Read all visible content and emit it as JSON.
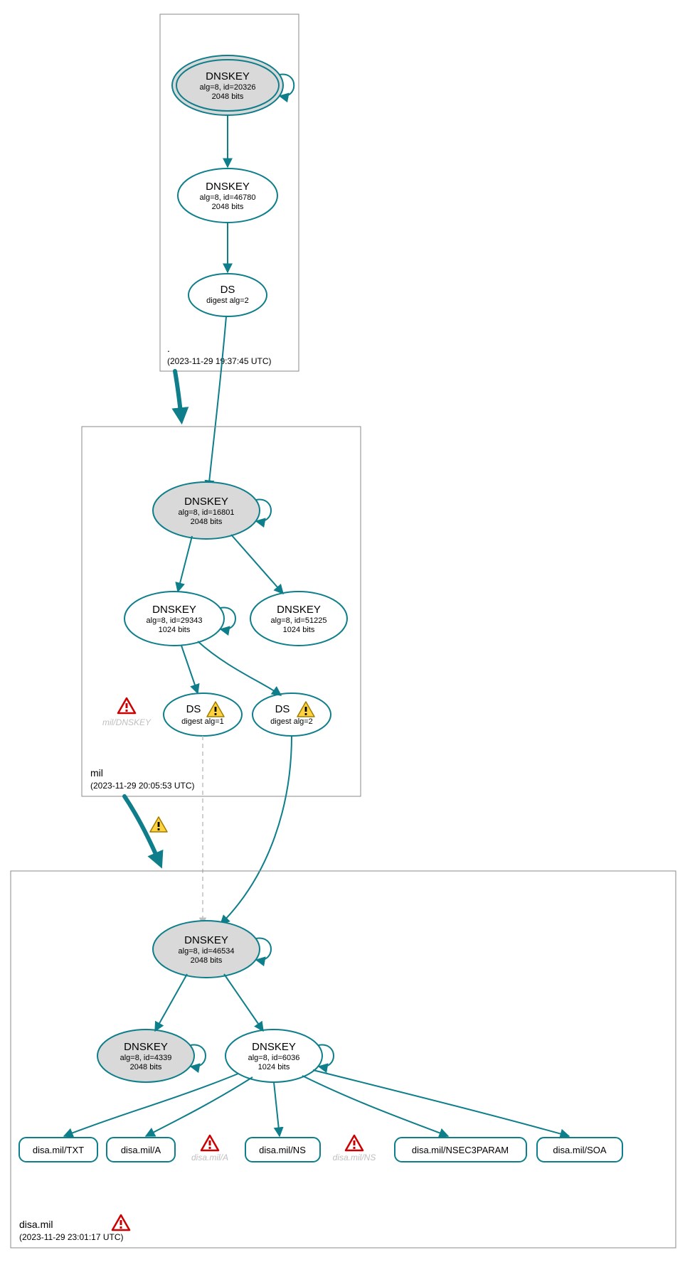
{
  "colors": {
    "stroke": "#0d7e8a",
    "ksk_fill": "#d9d9d9",
    "box_stroke": "#888888"
  },
  "zones": {
    "root": {
      "name": ".",
      "timestamp": "(2023-11-29 19:37:45 UTC)",
      "nodes": {
        "ksk": {
          "title": "DNSKEY",
          "line1": "alg=8, id=20326",
          "line2": "2048 bits"
        },
        "zsk": {
          "title": "DNSKEY",
          "line1": "alg=8, id=46780",
          "line2": "2048 bits"
        },
        "ds": {
          "title": "DS",
          "line1": "digest alg=2"
        }
      }
    },
    "mil": {
      "name": "mil",
      "timestamp": "(2023-11-29 20:05:53 UTC)",
      "nodes": {
        "ksk": {
          "title": "DNSKEY",
          "line1": "alg=8, id=16801",
          "line2": "2048 bits"
        },
        "zsk1": {
          "title": "DNSKEY",
          "line1": "alg=8, id=29343",
          "line2": "1024 bits"
        },
        "zsk2": {
          "title": "DNSKEY",
          "line1": "alg=8, id=51225",
          "line2": "1024 bits"
        },
        "ds1": {
          "title": "DS",
          "line1": "digest alg=1"
        },
        "ds2": {
          "title": "DS",
          "line1": "digest alg=2"
        }
      },
      "ghost_dnskey": "mil/DNSKEY"
    },
    "disa": {
      "name": "disa.mil",
      "timestamp": "(2023-11-29 23:01:17 UTC)",
      "nodes": {
        "ksk": {
          "title": "DNSKEY",
          "line1": "alg=8, id=46534",
          "line2": "2048 bits"
        },
        "ksk2": {
          "title": "DNSKEY",
          "line1": "alg=8, id=4339",
          "line2": "2048 bits"
        },
        "zsk": {
          "title": "DNSKEY",
          "line1": "alg=8, id=6036",
          "line2": "1024 bits"
        }
      },
      "rrs": {
        "txt": "disa.mil/TXT",
        "a": "disa.mil/A",
        "ns": "disa.mil/NS",
        "nsec3": "disa.mil/NSEC3PARAM",
        "soa": "disa.mil/SOA"
      },
      "ghosts": {
        "a": "disa.mil/A",
        "ns": "disa.mil/NS"
      }
    }
  },
  "icons": {
    "warn": "warning-triangle",
    "error": "error-triangle"
  }
}
